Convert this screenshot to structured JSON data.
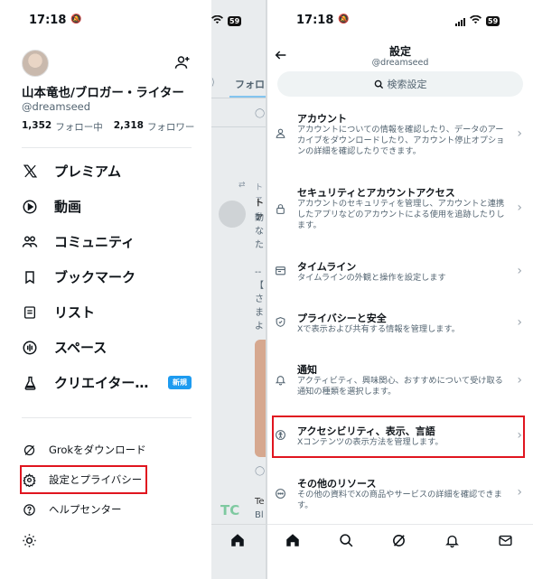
{
  "status_bar": {
    "time": "17:18",
    "battery": "59"
  },
  "drawer": {
    "display_name": "山本竜也/ブロガー・ライター",
    "handle": "@dreamseed",
    "following_count": "1,352",
    "following_label": "フォロー中",
    "followers_count": "2,318",
    "followers_label": "フォロワー",
    "menu": [
      {
        "label": "プレミアム",
        "icon": "x-logo-icon"
      },
      {
        "label": "動画",
        "icon": "play-circle-icon"
      },
      {
        "label": "コミュニティ",
        "icon": "people-icon"
      },
      {
        "label": "ブックマーク",
        "icon": "bookmark-icon"
      },
      {
        "label": "リスト",
        "icon": "list-icon"
      },
      {
        "label": "スペース",
        "icon": "microphone-icon"
      },
      {
        "label": "クリエイター…",
        "icon": "flask-icon",
        "badge": "新規"
      }
    ],
    "secondary": [
      {
        "label": "Grokをダウンロード",
        "icon": "grok-icon"
      },
      {
        "label": "設定とプライバシー",
        "icon": "gear-icon"
      },
      {
        "label": "ヘルプセンター",
        "icon": "question-icon"
      }
    ],
    "theme_icon": "sun-icon",
    "highlight_color": "#e0151f"
  },
  "background_feed": {
    "tab_label": "フォロ",
    "line_1": "トァ",
    "line_2": "動",
    "line_3": "な",
    "line_4": "た",
    "line_5": "--",
    "line_6": "【",
    "line_7": "さ",
    "line_8": "ま",
    "line_9": "よ",
    "bottom_text_1": "Te",
    "bottom_text_2": "Bl"
  },
  "settings": {
    "title": "設定",
    "handle": "@dreamseed",
    "search_placeholder": "検索設定",
    "items": [
      {
        "title": "アカウント",
        "desc": "アカウントについての情報を確認したり、データのアーカイブをダウンロードしたり、アカウント停止オプションの詳細を確認したりできます。",
        "icon": "person-icon"
      },
      {
        "title": "セキュリティとアカウントアクセス",
        "desc": "アカウントのセキュリティを管理し、アカウントと連携したアプリなどのアカウントによる使用を追跡したりします。",
        "icon": "lock-icon"
      },
      {
        "title": "タイムライン",
        "desc": "タイムラインの外観と操作を設定します",
        "icon": "timeline-icon"
      },
      {
        "title": "プライバシーと安全",
        "desc": "Xで表示および共有する情報を管理します。",
        "icon": "shield-icon"
      },
      {
        "title": "通知",
        "desc": "アクティビティ、興味関心、おすすめについて受け取る通知の種類を選択します。",
        "icon": "bell-icon"
      },
      {
        "title": "アクセシビリティ、表示、言語",
        "desc": "Xコンテンツの表示方法を管理します。",
        "icon": "accessibility-icon"
      },
      {
        "title": "その他のリソース",
        "desc": "その他の資料でXの商品やサービスの詳細を確認できます。",
        "icon": "more-icon"
      }
    ],
    "tabbar": [
      "home-icon",
      "search-icon",
      "grok-icon",
      "bell-icon",
      "mail-icon"
    ]
  }
}
